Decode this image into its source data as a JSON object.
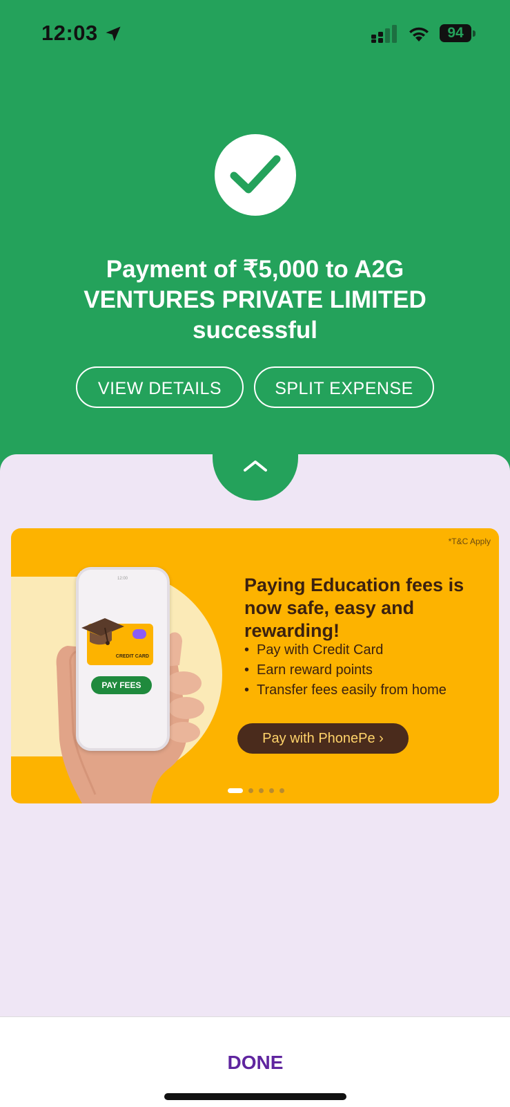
{
  "status_bar": {
    "time": "12:03",
    "battery": "94",
    "icons": [
      "location-arrow-icon",
      "cellular-signal-icon",
      "wifi-icon",
      "battery-icon"
    ]
  },
  "success": {
    "headline": "Payment of ₹5,000 to A2G VENTURES PRIVATE LIMITED successful",
    "icon": "checkmark-icon"
  },
  "actions": {
    "view_details": "VIEW DETAILS",
    "split_expense": "SPLIT EXPENSE"
  },
  "banner": {
    "tnc": "*T&C Apply",
    "title": "Paying Education fees is now safe, easy and rewarding!",
    "points": [
      "Pay with Credit Card",
      "Earn reward points",
      "Transfer fees easily from home"
    ],
    "cta": "Pay with PhonePe ›",
    "illustration": {
      "card_label": "CREDIT CARD",
      "button_label": "PAY FEES",
      "phone_time": "12:00"
    },
    "carousel": {
      "count": 5,
      "active_index": 0
    }
  },
  "footer": {
    "done": "DONE"
  },
  "colors": {
    "success_green": "#24a25b",
    "sheet_lavender": "#efe6f5",
    "banner_yellow": "#fdb300",
    "done_purple": "#5f259f",
    "cta_brown": "#4a2b1c"
  }
}
